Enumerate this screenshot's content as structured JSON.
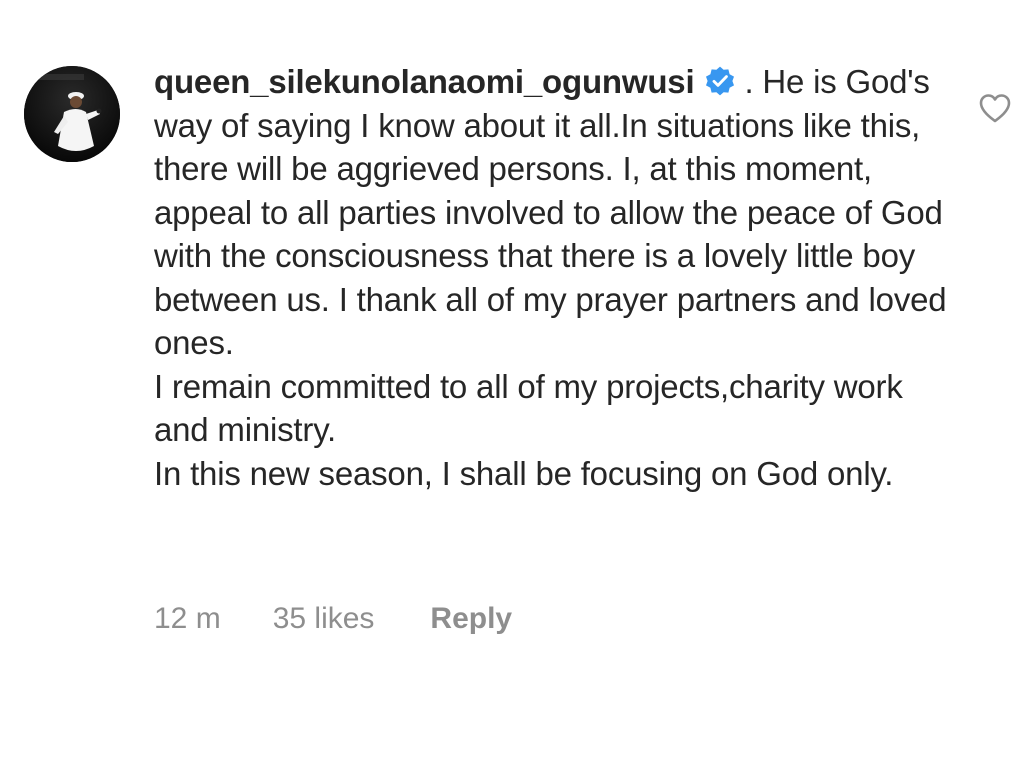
{
  "comment": {
    "username": "queen_silekunolanaomi_ogunwusi",
    "verified": true,
    "text": ". He is God's way of saying I know about it all.In situations like this, there will be aggrieved persons. I, at this moment, appeal to all parties involved to allow the peace of God with the consciousness that there is a lovely little boy between us. I thank all of my prayer partners and loved ones.\nI remain committed to all of my projects,charity work and ministry.\nIn this new season, I shall be focusing on God only.",
    "time": "12 m",
    "likes": "35 likes",
    "reply_label": "Reply"
  },
  "icons": {
    "verified": "verified-badge-icon",
    "like": "heart-outline-icon"
  },
  "colors": {
    "text": "#262626",
    "meta": "#8e8e8e",
    "verified_blue": "#3897f0"
  }
}
